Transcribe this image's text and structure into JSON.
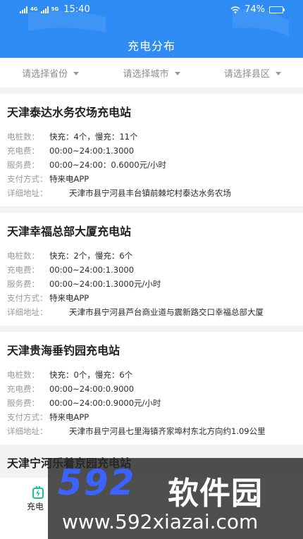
{
  "status_bar": {
    "signal1": "4G",
    "signal2": "5G",
    "time": "15:40",
    "battery": "74%",
    "battery_level": 0.74
  },
  "header": {
    "title": "充电分布"
  },
  "filters": [
    {
      "label": "请选择省份"
    },
    {
      "label": "请选择城市"
    },
    {
      "label": "请选择县区"
    }
  ],
  "labels": {
    "piles": "电桩数：",
    "fee": "充电费：",
    "service": "服务费：",
    "payment": "支付方式：",
    "address": "详细地址："
  },
  "stations": [
    {
      "name": "天津泰达水务农场充电站",
      "piles": "快充：4个，慢充：11个",
      "fee": "00:00~24:00:1.3000",
      "service": "00:00~24:00：0.6000元/小时",
      "payment": "特来电APP",
      "address": "天津市县宁河县丰台镇前棘坨村泰达水务农场"
    },
    {
      "name": "天津幸福总部大厦充电站",
      "piles": "快充：2个，慢充：6个",
      "fee": "00:00~24:00:1.3000",
      "service": "00:00~24:00:1.3000元/小时",
      "payment": "特来电APP",
      "address": "天津市县宁河县芦台商业道与震新路交口幸福总部大厦"
    },
    {
      "name": "天津贵海垂钓园充电站",
      "piles": "快充：0个，慢充：6个",
      "fee": "00:00~24:00:0.9000",
      "service": "00:00~24:00:0.9000元/小时",
      "payment": "特来电APP",
      "address": "天津市县宁河县七里海镇齐家埠村东北方向约1.09公里"
    }
  ],
  "partial_station": {
    "name": "天津宁河乐着京园充电站"
  },
  "bottom_nav": {
    "item_label": "充电"
  },
  "watermark": {
    "logo": "592",
    "brand": "软件园",
    "url": "www.592xiazai.com"
  },
  "colors": {
    "header_bg": "#2f8cf5",
    "accent_green": "#1cc48a"
  }
}
